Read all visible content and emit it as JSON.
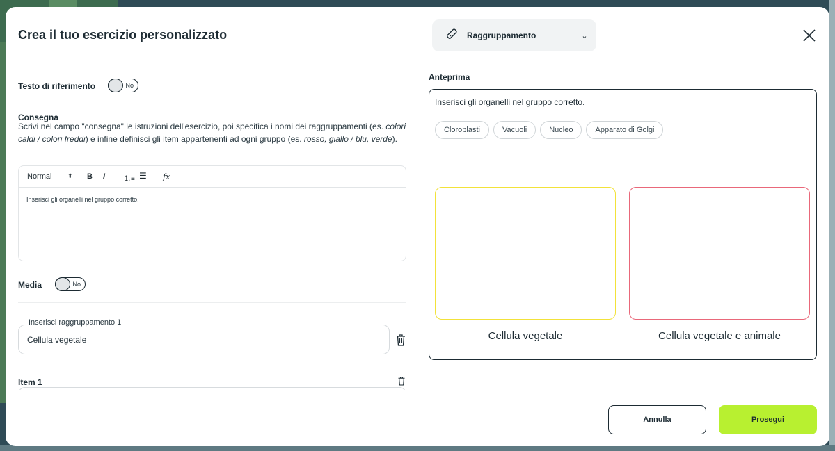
{
  "header": {
    "title": "Crea il tuo esercizio personalizzato",
    "exercise_type": "Raggruppamento"
  },
  "reference_text": {
    "label": "Testo di riferimento",
    "toggle": "No"
  },
  "consegna": {
    "label": "Consegna",
    "desc_1": "Scrivi nel campo \"consegna\" le istruzioni dell'esercizio, poi specifica i nomi dei raggruppamenti (es. ",
    "desc_example_1": "colori caldi / colori freddi",
    "desc_2": ") e infine definisci gli item appartenenti ad ogni gruppo (es. ",
    "desc_example_2": "rosso, giallo / blu, verde",
    "desc_3": ")."
  },
  "editor": {
    "format": "Normal",
    "bold": "B",
    "italic": "I",
    "formula": "fx",
    "content": "Inserisci gli organelli nel gruppo corretto."
  },
  "media": {
    "label": "Media",
    "toggle": "No"
  },
  "group1": {
    "label": "Inserisci raggruppamento 1",
    "value": "Cellula vegetale"
  },
  "item1": {
    "label": "Item 1"
  },
  "preview": {
    "label": "Anteprima",
    "instruction": "Inserisci gli organelli nel gruppo corretto.",
    "chips": [
      "Cloroplasti",
      "Vacuoli",
      "Nucleo",
      "Apparato di Golgi"
    ],
    "groups": [
      {
        "name": "Cellula vegetale",
        "color": "#f2e23a"
      },
      {
        "name": "Cellula vegetale e animale",
        "color": "#e9687a"
      }
    ]
  },
  "footer": {
    "cancel": "Annulla",
    "next": "Prosegui"
  }
}
